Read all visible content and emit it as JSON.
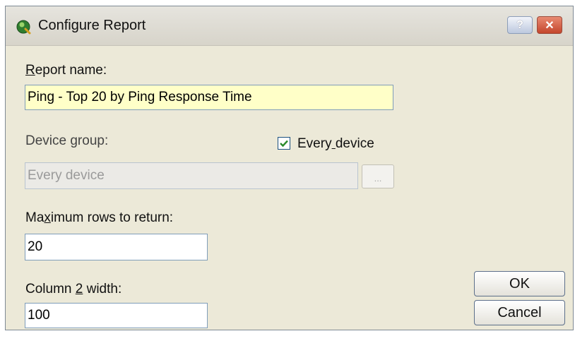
{
  "window": {
    "title": "Configure Report",
    "help_label": "?",
    "close_label": "✕"
  },
  "form": {
    "report_name": {
      "label_first": "R",
      "label_rest": "eport name:",
      "value": "Ping - Top 20 by Ping Response Time"
    },
    "device_group": {
      "label": "Device group:",
      "value": "Every device",
      "browse_label": "..."
    },
    "every_device": {
      "label_before": "Every",
      "label_underlined": " ",
      "label_after": "device",
      "checked": true,
      "display": "Every device"
    },
    "max_rows": {
      "label_before": "Ma",
      "label_underlined": "x",
      "label_after": "imum rows to return:",
      "value": "20"
    },
    "column2_width": {
      "label_before": "Column ",
      "label_underlined": "2",
      "label_after": " width:",
      "value": "100"
    }
  },
  "buttons": {
    "ok_label": "OK",
    "cancel_label": "Cancel"
  },
  "colors": {
    "dialog_bg": "#ece9d8",
    "field_highlight": "#ffffc8",
    "checkmark": "#2a8a2a"
  }
}
